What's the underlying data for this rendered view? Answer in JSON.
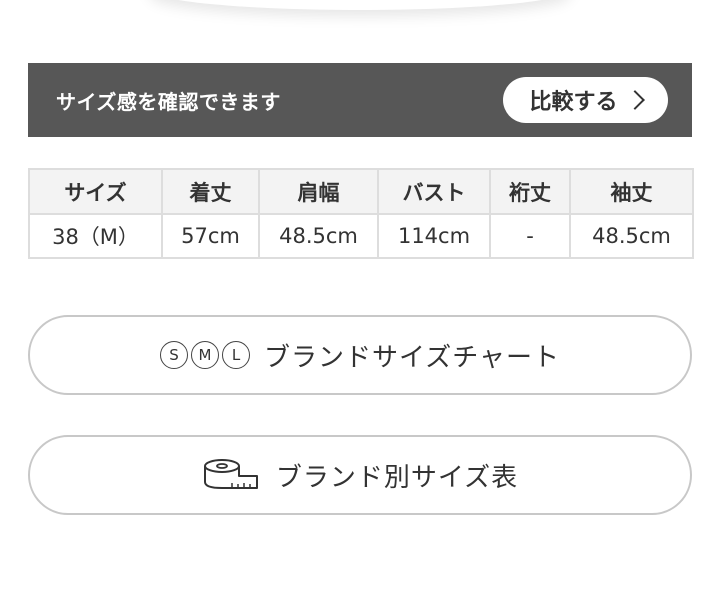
{
  "compare": {
    "text": "サイズ感を確認できます",
    "button_label": "比較する"
  },
  "size_table": {
    "headers": [
      "サイズ",
      "着丈",
      "肩幅",
      "バスト",
      "裄丈",
      "袖丈"
    ],
    "rows": [
      [
        "38（M）",
        "57cm",
        "48.5cm",
        "114cm",
        "-",
        "48.5cm"
      ]
    ]
  },
  "size_chart_button": {
    "icon_letters": [
      "S",
      "M",
      "L"
    ],
    "label": "ブランドサイズチャート"
  },
  "size_table_button": {
    "icon": "measuring-tape-icon",
    "label": "ブランド別サイズ表"
  }
}
